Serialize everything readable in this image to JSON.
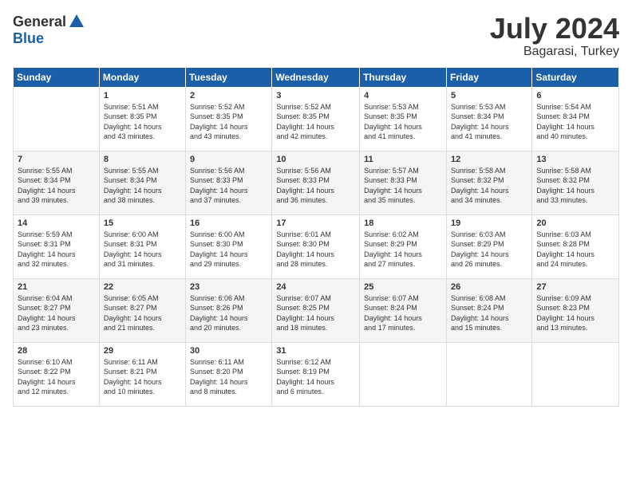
{
  "header": {
    "logo": {
      "general": "General",
      "blue": "Blue"
    },
    "title": "July 2024",
    "location": "Bagarasi, Turkey"
  },
  "calendar": {
    "days_of_week": [
      "Sunday",
      "Monday",
      "Tuesday",
      "Wednesday",
      "Thursday",
      "Friday",
      "Saturday"
    ],
    "weeks": [
      [
        {
          "day": "",
          "sunrise": "",
          "sunset": "",
          "daylight": ""
        },
        {
          "day": "1",
          "sunrise": "Sunrise: 5:51 AM",
          "sunset": "Sunset: 8:35 PM",
          "daylight": "Daylight: 14 hours and 43 minutes."
        },
        {
          "day": "2",
          "sunrise": "Sunrise: 5:52 AM",
          "sunset": "Sunset: 8:35 PM",
          "daylight": "Daylight: 14 hours and 43 minutes."
        },
        {
          "day": "3",
          "sunrise": "Sunrise: 5:52 AM",
          "sunset": "Sunset: 8:35 PM",
          "daylight": "Daylight: 14 hours and 42 minutes."
        },
        {
          "day": "4",
          "sunrise": "Sunrise: 5:53 AM",
          "sunset": "Sunset: 8:35 PM",
          "daylight": "Daylight: 14 hours and 41 minutes."
        },
        {
          "day": "5",
          "sunrise": "Sunrise: 5:53 AM",
          "sunset": "Sunset: 8:34 PM",
          "daylight": "Daylight: 14 hours and 41 minutes."
        },
        {
          "day": "6",
          "sunrise": "Sunrise: 5:54 AM",
          "sunset": "Sunset: 8:34 PM",
          "daylight": "Daylight: 14 hours and 40 minutes."
        }
      ],
      [
        {
          "day": "7",
          "sunrise": "Sunrise: 5:55 AM",
          "sunset": "Sunset: 8:34 PM",
          "daylight": "Daylight: 14 hours and 39 minutes."
        },
        {
          "day": "8",
          "sunrise": "Sunrise: 5:55 AM",
          "sunset": "Sunset: 8:34 PM",
          "daylight": "Daylight: 14 hours and 38 minutes."
        },
        {
          "day": "9",
          "sunrise": "Sunrise: 5:56 AM",
          "sunset": "Sunset: 8:33 PM",
          "daylight": "Daylight: 14 hours and 37 minutes."
        },
        {
          "day": "10",
          "sunrise": "Sunrise: 5:56 AM",
          "sunset": "Sunset: 8:33 PM",
          "daylight": "Daylight: 14 hours and 36 minutes."
        },
        {
          "day": "11",
          "sunrise": "Sunrise: 5:57 AM",
          "sunset": "Sunset: 8:33 PM",
          "daylight": "Daylight: 14 hours and 35 minutes."
        },
        {
          "day": "12",
          "sunrise": "Sunrise: 5:58 AM",
          "sunset": "Sunset: 8:32 PM",
          "daylight": "Daylight: 14 hours and 34 minutes."
        },
        {
          "day": "13",
          "sunrise": "Sunrise: 5:58 AM",
          "sunset": "Sunset: 8:32 PM",
          "daylight": "Daylight: 14 hours and 33 minutes."
        }
      ],
      [
        {
          "day": "14",
          "sunrise": "Sunrise: 5:59 AM",
          "sunset": "Sunset: 8:31 PM",
          "daylight": "Daylight: 14 hours and 32 minutes."
        },
        {
          "day": "15",
          "sunrise": "Sunrise: 6:00 AM",
          "sunset": "Sunset: 8:31 PM",
          "daylight": "Daylight: 14 hours and 31 minutes."
        },
        {
          "day": "16",
          "sunrise": "Sunrise: 6:00 AM",
          "sunset": "Sunset: 8:30 PM",
          "daylight": "Daylight: 14 hours and 29 minutes."
        },
        {
          "day": "17",
          "sunrise": "Sunrise: 6:01 AM",
          "sunset": "Sunset: 8:30 PM",
          "daylight": "Daylight: 14 hours and 28 minutes."
        },
        {
          "day": "18",
          "sunrise": "Sunrise: 6:02 AM",
          "sunset": "Sunset: 8:29 PM",
          "daylight": "Daylight: 14 hours and 27 minutes."
        },
        {
          "day": "19",
          "sunrise": "Sunrise: 6:03 AM",
          "sunset": "Sunset: 8:29 PM",
          "daylight": "Daylight: 14 hours and 26 minutes."
        },
        {
          "day": "20",
          "sunrise": "Sunrise: 6:03 AM",
          "sunset": "Sunset: 8:28 PM",
          "daylight": "Daylight: 14 hours and 24 minutes."
        }
      ],
      [
        {
          "day": "21",
          "sunrise": "Sunrise: 6:04 AM",
          "sunset": "Sunset: 8:27 PM",
          "daylight": "Daylight: 14 hours and 23 minutes."
        },
        {
          "day": "22",
          "sunrise": "Sunrise: 6:05 AM",
          "sunset": "Sunset: 8:27 PM",
          "daylight": "Daylight: 14 hours and 21 minutes."
        },
        {
          "day": "23",
          "sunrise": "Sunrise: 6:06 AM",
          "sunset": "Sunset: 8:26 PM",
          "daylight": "Daylight: 14 hours and 20 minutes."
        },
        {
          "day": "24",
          "sunrise": "Sunrise: 6:07 AM",
          "sunset": "Sunset: 8:25 PM",
          "daylight": "Daylight: 14 hours and 18 minutes."
        },
        {
          "day": "25",
          "sunrise": "Sunrise: 6:07 AM",
          "sunset": "Sunset: 8:24 PM",
          "daylight": "Daylight: 14 hours and 17 minutes."
        },
        {
          "day": "26",
          "sunrise": "Sunrise: 6:08 AM",
          "sunset": "Sunset: 8:24 PM",
          "daylight": "Daylight: 14 hours and 15 minutes."
        },
        {
          "day": "27",
          "sunrise": "Sunrise: 6:09 AM",
          "sunset": "Sunset: 8:23 PM",
          "daylight": "Daylight: 14 hours and 13 minutes."
        }
      ],
      [
        {
          "day": "28",
          "sunrise": "Sunrise: 6:10 AM",
          "sunset": "Sunset: 8:22 PM",
          "daylight": "Daylight: 14 hours and 12 minutes."
        },
        {
          "day": "29",
          "sunrise": "Sunrise: 6:11 AM",
          "sunset": "Sunset: 8:21 PM",
          "daylight": "Daylight: 14 hours and 10 minutes."
        },
        {
          "day": "30",
          "sunrise": "Sunrise: 6:11 AM",
          "sunset": "Sunset: 8:20 PM",
          "daylight": "Daylight: 14 hours and 8 minutes."
        },
        {
          "day": "31",
          "sunrise": "Sunrise: 6:12 AM",
          "sunset": "Sunset: 8:19 PM",
          "daylight": "Daylight: 14 hours and 6 minutes."
        },
        {
          "day": "",
          "sunrise": "",
          "sunset": "",
          "daylight": ""
        },
        {
          "day": "",
          "sunrise": "",
          "sunset": "",
          "daylight": ""
        },
        {
          "day": "",
          "sunrise": "",
          "sunset": "",
          "daylight": ""
        }
      ]
    ]
  }
}
